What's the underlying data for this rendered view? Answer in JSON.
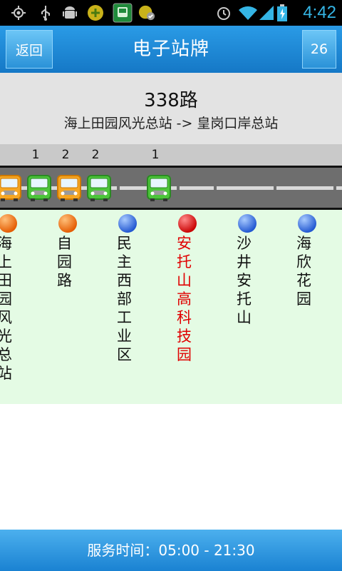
{
  "status_bar": {
    "time": "4:42",
    "icons": [
      "gps-icon",
      "usb-icon",
      "android-debug-icon",
      "app-icon",
      "bus-app-icon",
      "app-check-icon",
      "alarm-icon",
      "wifi-icon",
      "signal-icon",
      "battery-charging-icon"
    ]
  },
  "titlebar": {
    "back_label": "返回",
    "title": "电子站牌",
    "count_label": "26"
  },
  "route": {
    "number": "338路",
    "direction": "海上田园风光总站 -> 皇岗口岸总站"
  },
  "bus_counts": [
    "1",
    "2",
    "2",
    "1"
  ],
  "buses": [
    {
      "color": "orange"
    },
    {
      "color": "green"
    },
    {
      "color": "orange"
    },
    {
      "color": "green"
    },
    {
      "color": "green"
    }
  ],
  "stations": [
    {
      "name": "海上田园风光总站",
      "ball_color": "orange",
      "current": false
    },
    {
      "name": "自园路",
      "ball_color": "orange",
      "current": false
    },
    {
      "name": "民主西部工业区",
      "ball_color": "blue",
      "current": false
    },
    {
      "name": "安托山高科技园",
      "ball_color": "red",
      "current": true
    },
    {
      "name": "沙井安托山",
      "ball_color": "blue",
      "current": false
    },
    {
      "name": "海欣花园",
      "ball_color": "blue",
      "current": false
    }
  ],
  "colors": {
    "orange": "#f07a10",
    "green": "#3aa832",
    "blue": "#2f6fe0",
    "red": "#d80000"
  },
  "footer": {
    "service_time": "服务时间：05:00 - 21:30"
  }
}
